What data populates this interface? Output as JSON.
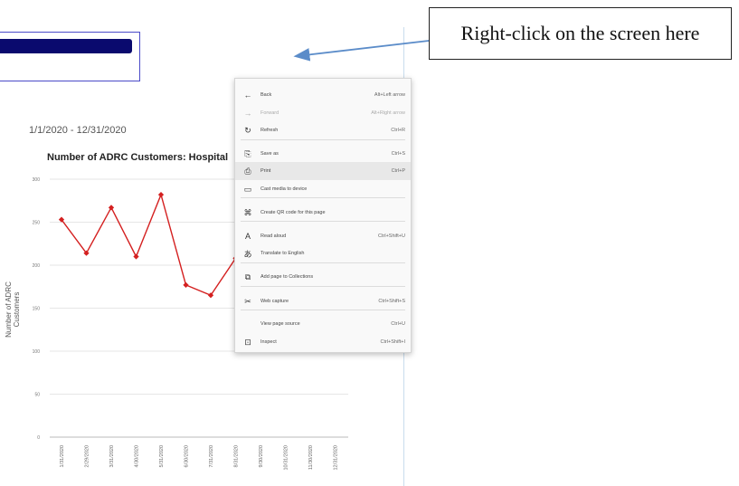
{
  "callout": {
    "text": "Right-click on the screen here"
  },
  "report": {
    "date_range": "1/1/2020 - 12/31/2020",
    "chart_title": "Number of ADRC Customers: Hospital",
    "y_axis_title": "Number of ADRC Customers"
  },
  "chart_data": {
    "type": "line",
    "title": "Number of ADRC Customers: Hospital",
    "ylabel": "Number of ADRC Customers",
    "xlabel": "",
    "x": [
      "1/31/2020",
      "2/29/2020",
      "3/31/2020",
      "4/30/2020",
      "5/31/2020",
      "6/30/2020",
      "7/31/2020",
      "8/31/2020",
      "9/30/2020",
      "10/31/2020",
      "11/30/2020",
      "12/31/2020"
    ],
    "y_ticks": [
      "0",
      "50",
      "100",
      "150",
      "200",
      "250",
      "300"
    ],
    "ylim": [
      0,
      300
    ],
    "grid": true,
    "series": [
      {
        "color": "#d42020",
        "values": [
          253,
          214,
          267,
          210,
          282,
          177,
          165,
          208,
          null,
          null,
          null,
          null
        ]
      }
    ]
  },
  "context_menu": {
    "items": [
      {
        "icon": "←",
        "label": "Back",
        "shortcut": "Alt+Left arrow",
        "disabled": false,
        "highlight": false
      },
      {
        "icon": "→",
        "label": "Forward",
        "shortcut": "Alt+Right arrow",
        "disabled": true,
        "highlight": false
      },
      {
        "icon": "↻",
        "label": "Refresh",
        "shortcut": "Ctrl+R",
        "disabled": false,
        "highlight": false
      },
      {
        "icon": "⎘",
        "label": "Save as",
        "shortcut": "Ctrl+S",
        "disabled": false,
        "highlight": false
      },
      {
        "icon": "⎙",
        "label": "Print",
        "shortcut": "Ctrl+P",
        "disabled": false,
        "highlight": true
      },
      {
        "icon": "▭",
        "label": "Cast media to device",
        "shortcut": "",
        "disabled": false,
        "highlight": false
      },
      {
        "icon": "⌘",
        "label": "Create QR code for this page",
        "shortcut": "",
        "disabled": false,
        "highlight": false
      },
      {
        "icon": "A",
        "label": "Read aloud",
        "shortcut": "Ctrl+Shift+U",
        "disabled": false,
        "highlight": false
      },
      {
        "icon": "あ",
        "label": "Translate to English",
        "shortcut": "",
        "disabled": false,
        "highlight": false
      },
      {
        "icon": "⧉",
        "label": "Add page to Collections",
        "shortcut": "",
        "disabled": false,
        "highlight": false
      },
      {
        "icon": "✂",
        "label": "Web capture",
        "shortcut": "Ctrl+Shift+S",
        "disabled": false,
        "highlight": false
      },
      {
        "icon": "",
        "label": "View page source",
        "shortcut": "Ctrl+U",
        "disabled": false,
        "highlight": false
      },
      {
        "icon": "⊡",
        "label": "Inspect",
        "shortcut": "Ctrl+Shift+I",
        "disabled": false,
        "highlight": false
      }
    ]
  }
}
